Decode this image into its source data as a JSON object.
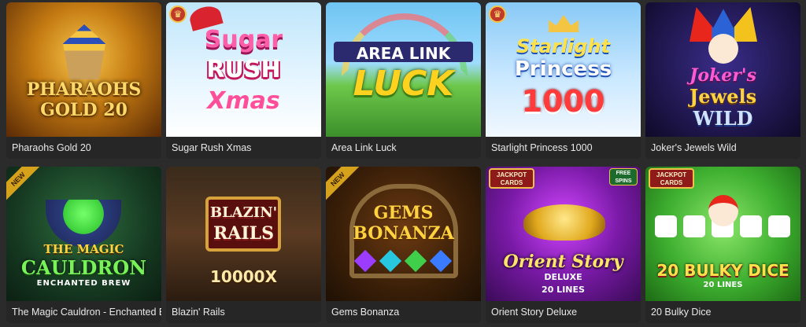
{
  "games": [
    {
      "title": "Pharaohs Gold 20",
      "logo": [
        "PHARAOHS",
        "GOLD 20"
      ]
    },
    {
      "title": "Sugar Rush Xmas",
      "logo": [
        "Sugar",
        "RUSH",
        "Xmas"
      ]
    },
    {
      "title": "Area Link Luck",
      "logo": [
        "AREA LINK",
        "LUCK"
      ]
    },
    {
      "title": "Starlight Princess 1000",
      "logo": [
        "Starlight",
        "Princess",
        "1000"
      ]
    },
    {
      "title": "Joker's Jewels Wild",
      "logo": [
        "Joker's",
        "Jewels",
        "WILD"
      ]
    },
    {
      "title": "The Magic Cauldron - Enchanted Brew",
      "logo": [
        "THE MAGIC",
        "CAULDRON",
        "ENCHANTED BREW"
      ],
      "badge": "NEW"
    },
    {
      "title": "Blazin' Rails",
      "logo": [
        "BLAZIN'",
        "RAILS",
        "10000X"
      ]
    },
    {
      "title": "Gems Bonanza",
      "logo": [
        "GEMS",
        "BONANZA"
      ],
      "badge": "NEW"
    },
    {
      "title": "Orient Story Deluxe",
      "logo": [
        "Orient Story",
        "DELUXE",
        "20 LINES"
      ],
      "jackpot": "JACKPOT CARDS",
      "free": "FREE SPINS"
    },
    {
      "title": "20 Bulky Dice",
      "logo": [
        "20 BULKY DICE",
        "20 LINES"
      ],
      "jackpot": "JACKPOT CARDS"
    }
  ],
  "colors": {
    "background": "#2b2b2b",
    "caption_bg": "#262626",
    "caption_text": "#e9e9e9"
  }
}
